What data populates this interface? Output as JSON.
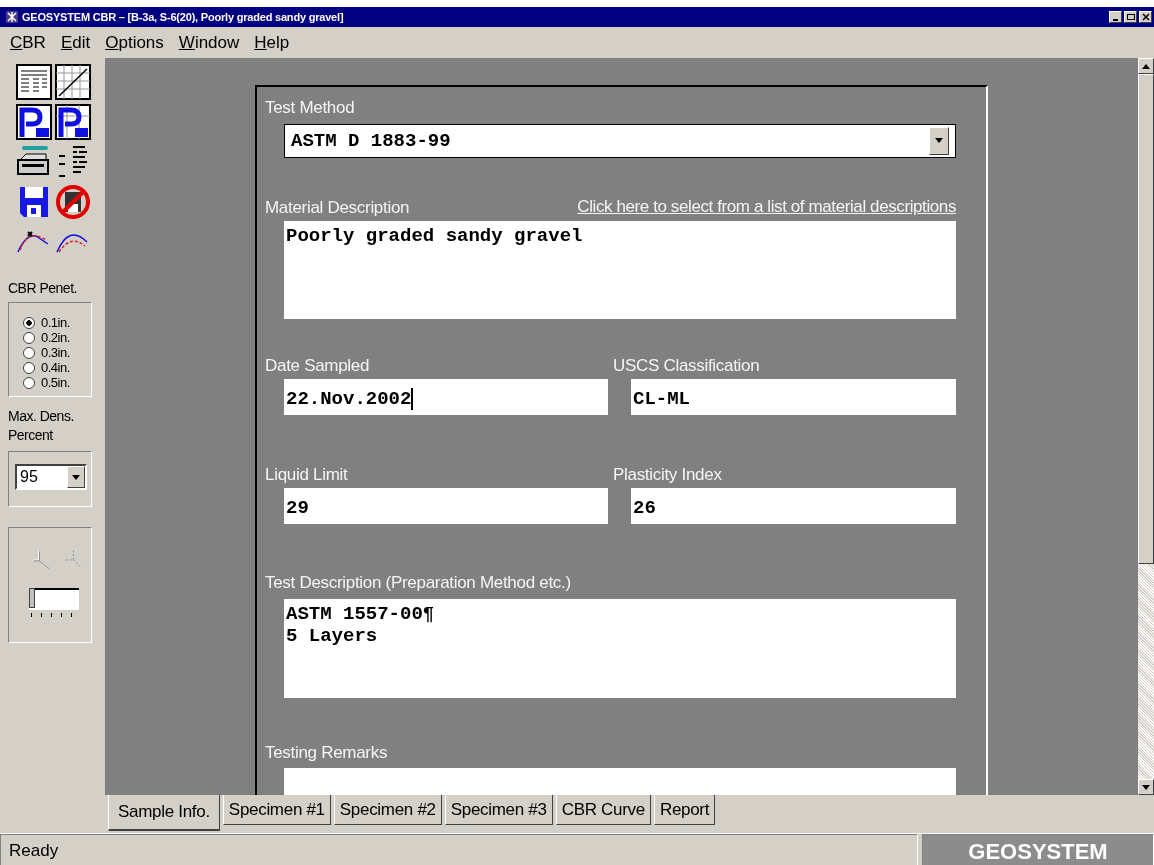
{
  "window": {
    "title": "GEOSYSTEM CBR – [B-3a, S-6(20), Poorly graded sandy gravel]"
  },
  "menu": [
    "CBR",
    "Edit",
    "Options",
    "Window",
    "Help"
  ],
  "penetration": {
    "label": "CBR Penet.",
    "options": [
      {
        "label": "0.1in.",
        "selected": true
      },
      {
        "label": "0.2in.",
        "selected": false
      },
      {
        "label": "0.3in.",
        "selected": false
      },
      {
        "label": "0.4in.",
        "selected": false
      },
      {
        "label": "0.5in.",
        "selected": false
      }
    ]
  },
  "max_density": {
    "label": "Max. Dens. Percent",
    "value": "95"
  },
  "zoom_slider": {
    "level": 0
  },
  "form": {
    "test_method": {
      "label": "Test Method",
      "value": "ASTM D 1883-99"
    },
    "material_description": {
      "label": "Material Description",
      "link": "Click here to select from a list of material descriptions",
      "value": "Poorly graded sandy gravel"
    },
    "date_sampled": {
      "label": "Date Sampled",
      "value": "22.Nov.2002"
    },
    "uscs_classification": {
      "label": "USCS Classification",
      "value": "CL-ML"
    },
    "liquid_limit": {
      "label": "Liquid Limit",
      "value": "29"
    },
    "plasticity_index": {
      "label": "Plasticity Index",
      "value": "26"
    },
    "test_description": {
      "label": "Test Description (Preparation Method etc.)",
      "lines": [
        "ASTM 1557-00¶",
        "5 Layers"
      ]
    },
    "testing_remarks": {
      "label": "Testing Remarks"
    }
  },
  "tabs": [
    {
      "label": "Sample Info.",
      "selected": true
    },
    {
      "label": "Specimen #1",
      "selected": false
    },
    {
      "label": "Specimen #2",
      "selected": false
    },
    {
      "label": "Specimen #3",
      "selected": false
    },
    {
      "label": "CBR Curve",
      "selected": false
    },
    {
      "label": "Report",
      "selected": false
    }
  ],
  "status_bar": {
    "text": "Ready",
    "brand": "GEOSYSTEM"
  }
}
